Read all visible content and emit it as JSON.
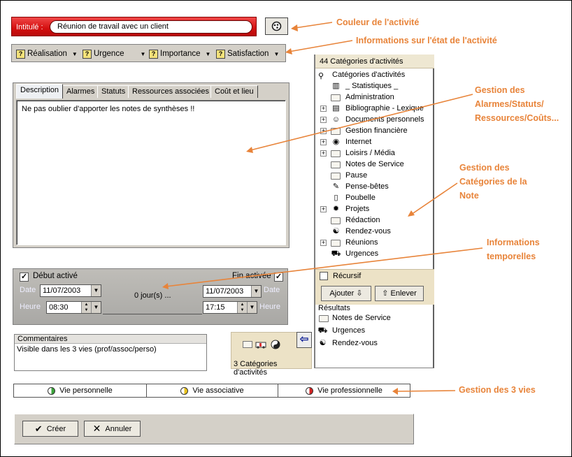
{
  "annotations": {
    "couleur": "Couleur de l'activité",
    "etat": "Informations sur l'état de l'activité",
    "alarmes": [
      "Gestion des",
      "Alarmes/Statuts/",
      "Ressources/Coûts..."
    ],
    "categories": [
      "Gestion des",
      "Catégories de la",
      "Note"
    ],
    "temporelles": [
      "Informations",
      "temporelles"
    ],
    "vies": "Gestion des 3 vies"
  },
  "title_row": {
    "label": "Intitulé :",
    "value": "Réunion de travail avec un client"
  },
  "status_dropdowns": [
    {
      "label": "Réalisation"
    },
    {
      "label": "Urgence"
    },
    {
      "label": "Importance"
    },
    {
      "label": "Satisfaction"
    }
  ],
  "tabs": [
    "Description",
    "Alarmes",
    "Statuts",
    "Ressources associées",
    "Coût et lieu"
  ],
  "description_text": "Ne pas oublier d'apporter les notes de synthèses !!",
  "dates": {
    "start_label": "Début activé",
    "end_label": "Fin activée",
    "date_label": "Date",
    "heure_label": "Heure",
    "start_date": "11/07/2003",
    "end_date": "11/07/2003",
    "start_time": "08:30",
    "end_time": "17:15",
    "duration": "0 jour(s) ...",
    "start_checked": true,
    "end_checked": true
  },
  "comments": {
    "header": "Commentaires",
    "text": "Visible dans les 3 vies (prof/assoc/perso)"
  },
  "category_summary": {
    "count_label": "3 Catégories d'activités"
  },
  "categories_panel": {
    "header": "44  Catégories d'activités",
    "root": "Catégories d'activités",
    "items": [
      {
        "label": "_ Statistiques _",
        "expandable": false,
        "icon": "books-icon"
      },
      {
        "label": "Administration",
        "expandable": false,
        "icon": "folder-icon"
      },
      {
        "label": "Bibliographie - Lexique",
        "expandable": true,
        "icon": "book-icon"
      },
      {
        "label": "Documents personnels",
        "expandable": true,
        "icon": "person-icon"
      },
      {
        "label": "Gestion financière",
        "expandable": true,
        "icon": "folder-icon"
      },
      {
        "label": "Internet",
        "expandable": true,
        "icon": "globe-icon"
      },
      {
        "label": "Loisirs / Média",
        "expandable": true,
        "icon": "folder-icon"
      },
      {
        "label": "Notes de Service",
        "expandable": false,
        "icon": "folder-icon"
      },
      {
        "label": "Pause",
        "expandable": false,
        "icon": "folder-icon"
      },
      {
        "label": "Pense-bêtes",
        "expandable": false,
        "icon": "note-icon"
      },
      {
        "label": "Poubelle",
        "expandable": false,
        "icon": "trash-icon"
      },
      {
        "label": "Projets",
        "expandable": true,
        "icon": "gear-icon"
      },
      {
        "label": "Rédaction",
        "expandable": false,
        "icon": "folder-icon"
      },
      {
        "label": "Rendez-vous",
        "expandable": false,
        "icon": "yin-yang-icon"
      },
      {
        "label": "Réunions",
        "expandable": true,
        "icon": "folder-icon"
      },
      {
        "label": "Urgences",
        "expandable": false,
        "icon": "ambulance-icon"
      }
    ],
    "recursive_label": "Récursif",
    "add_label": "Ajouter",
    "remove_label": "Enlever",
    "results_label": "Résultats",
    "results": [
      {
        "label": "Notes de Service",
        "icon": "folder-icon"
      },
      {
        "label": "Urgences",
        "icon": "ambulance-icon"
      },
      {
        "label": "Rendez-vous",
        "icon": "yin-yang-icon"
      }
    ]
  },
  "vies": [
    {
      "label": "Vie personnelle",
      "color": "#3aa43a"
    },
    {
      "label": "Vie associative",
      "color": "#e8c21c"
    },
    {
      "label": "Vie professionnelle",
      "color": "#d42222"
    }
  ],
  "buttons": {
    "create": "Créer",
    "cancel": "Annuler"
  }
}
